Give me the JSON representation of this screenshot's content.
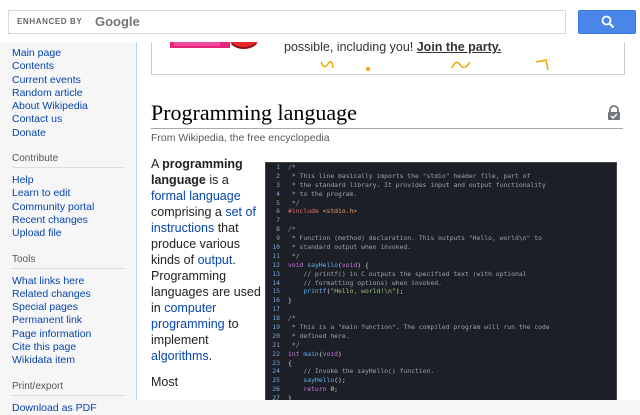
{
  "search": {
    "enhanced_label": "ENHANCED BY",
    "google_label": "Google",
    "query": "",
    "placeholder": ""
  },
  "sidebar": {
    "nav": [
      "Main page",
      "Contents",
      "Current events",
      "Random article",
      "About Wikipedia",
      "Contact us",
      "Donate"
    ],
    "contribute_heading": "Contribute",
    "contribute": [
      "Help",
      "Learn to edit",
      "Community portal",
      "Recent changes",
      "Upload file"
    ],
    "tools_heading": "Tools",
    "tools": [
      "What links here",
      "Related changes",
      "Special pages",
      "Permanent link",
      "Page information",
      "Cite this page",
      "Wikidata item"
    ],
    "print_heading": "Print/export",
    "print": [
      "Download as PDF"
    ]
  },
  "banner": {
    "text": "possible, including you!",
    "link": "Join the party."
  },
  "article": {
    "title": "Programming language",
    "subtitle": "From Wikipedia, the free encyclopedia",
    "lead": {
      "t1": "A ",
      "b1": "programming language",
      "t2": " is a ",
      "l1": "formal language",
      "t3": " comprising a ",
      "l2": "set of instructions",
      "t4": " that produce various kinds of ",
      "l3": "output",
      "t5": ". Programming languages are used in ",
      "l4": "computer programming",
      "t6": " to implement ",
      "l5": "algorithms",
      "t7": ".",
      "p2": "Most"
    }
  },
  "code": [
    {
      "n": "1",
      "parts": [
        [
          "c-com",
          "/*"
        ]
      ]
    },
    {
      "n": "2",
      "parts": [
        [
          "c-com",
          " * This line basically imports the \"stdio\" header file, part of"
        ]
      ]
    },
    {
      "n": "3",
      "parts": [
        [
          "c-com",
          " * the standard library. It provides input and output functionality"
        ]
      ]
    },
    {
      "n": "4",
      "parts": [
        [
          "c-com",
          " * to the program."
        ]
      ]
    },
    {
      "n": "5",
      "parts": [
        [
          "c-com",
          " */"
        ]
      ]
    },
    {
      "n": "6",
      "parts": [
        [
          "c-pre",
          "#include "
        ],
        [
          "c-inc",
          "<stdio.h>"
        ]
      ]
    },
    {
      "n": "7",
      "parts": []
    },
    {
      "n": "8",
      "parts": [
        [
          "c-com",
          "/*"
        ]
      ]
    },
    {
      "n": "9",
      "parts": [
        [
          "c-com",
          " * Function (method) declaration. This outputs \"Hello, world\\n\" to"
        ]
      ]
    },
    {
      "n": "10",
      "parts": [
        [
          "c-com",
          " * standard output when invoked."
        ]
      ]
    },
    {
      "n": "11",
      "parts": [
        [
          "c-com",
          " */"
        ]
      ]
    },
    {
      "n": "12",
      "parts": [
        [
          "c-kw",
          "void "
        ],
        [
          "c-fn",
          "sayHello"
        ],
        [
          "c-pun",
          "("
        ],
        [
          "c-kw",
          "void"
        ],
        [
          "c-pun",
          ") {"
        ]
      ]
    },
    {
      "n": "13",
      "parts": [
        [
          "c-com",
          "    // printf() in C outputs the specified text (with optional"
        ]
      ]
    },
    {
      "n": "14",
      "parts": [
        [
          "c-com",
          "    // formatting options) when invoked."
        ]
      ]
    },
    {
      "n": "15",
      "parts": [
        [
          "c-fn",
          "    printf"
        ],
        [
          "c-pun",
          "("
        ],
        [
          "c-str",
          "\"Hello, world!\\n\""
        ],
        [
          "c-pun",
          ");"
        ]
      ]
    },
    {
      "n": "16",
      "parts": [
        [
          "c-pun",
          "}"
        ]
      ]
    },
    {
      "n": "17",
      "parts": []
    },
    {
      "n": "18",
      "parts": [
        [
          "c-com",
          "/*"
        ]
      ]
    },
    {
      "n": "19",
      "parts": [
        [
          "c-com",
          " * This is a \"main function\". The compiled program will run the code"
        ]
      ]
    },
    {
      "n": "20",
      "parts": [
        [
          "c-com",
          " * defined here."
        ]
      ]
    },
    {
      "n": "21",
      "parts": [
        [
          "c-com",
          " */"
        ]
      ]
    },
    {
      "n": "22",
      "parts": [
        [
          "c-kw",
          "int "
        ],
        [
          "c-fn",
          "main"
        ],
        [
          "c-pun",
          "("
        ],
        [
          "c-kw",
          "void"
        ],
        [
          "c-pun",
          ")"
        ]
      ]
    },
    {
      "n": "23",
      "parts": [
        [
          "c-pun",
          "{"
        ]
      ]
    },
    {
      "n": "24",
      "parts": [
        [
          "c-com",
          "    // Invoke the sayHello() function."
        ]
      ]
    },
    {
      "n": "25",
      "parts": [
        [
          "c-fn",
          "    sayHello"
        ],
        [
          "c-pun",
          "();"
        ]
      ]
    },
    {
      "n": "26",
      "parts": [
        [
          "c-kw",
          "    return "
        ],
        [
          "c-pun",
          "0;"
        ]
      ]
    },
    {
      "n": "27",
      "parts": [
        [
          "c-pun",
          "}"
        ]
      ]
    }
  ]
}
